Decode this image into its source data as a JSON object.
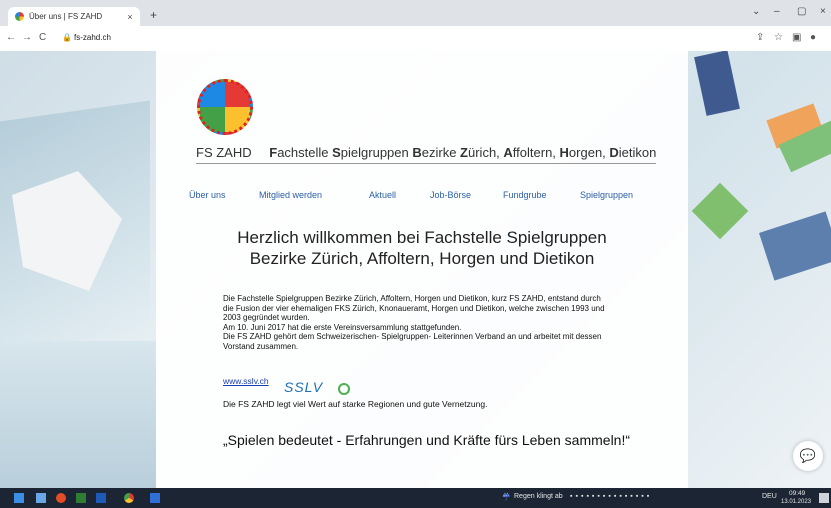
{
  "browser": {
    "tab_title": "Über uns | FS ZAHD",
    "tab_close": "×",
    "new_tab": "+",
    "url": "fs-zahd.ch",
    "win_minimize": "–",
    "win_maximize": "▢",
    "win_close": "×",
    "tab_dropdown": "⌄"
  },
  "page": {
    "brand": {
      "abbr": "FS ZAHD",
      "parts": [
        {
          "bold": "F",
          "rest": "achstelle "
        },
        {
          "bold": "S",
          "rest": "pielgruppen "
        },
        {
          "bold": "B",
          "rest": "ezirke "
        },
        {
          "bold": "Z",
          "rest": "ürich, "
        },
        {
          "bold": "A",
          "rest": "ffoltern, "
        },
        {
          "bold": "H",
          "rest": "orgen, "
        },
        {
          "bold": "D",
          "rest": "ietikon"
        }
      ]
    },
    "menu": [
      "Über uns",
      "Mitglied werden",
      "Aktuell",
      "Job-Börse",
      "Fundgrube",
      "Spielgruppen"
    ],
    "heading_line1": "Herzlich willkommen bei Fachstelle Spielgruppen",
    "heading_line2": "Bezirke Zürich, Affoltern, Horgen und Dietikon",
    "paragraph_lines": [
      "Die Fachstelle Spielgruppen Bezirke Zürich, Affoltern, Horgen und Dietikon, kurz FS ZAHD, entstand durch",
      "die Fusion der vier ehemaligen FKS Zürich, Knonaueramt, Horgen und Dietikon, welche zwischen 1993 und",
      "2003 gegründet wurden.",
      "Am 10. Juni 2017 hat die erste Vereinsversammlung stattgefunden.",
      "Die FS ZAHD gehört dem Schweizerischen- Spielgruppen- Leiterinnen Verband an und arbeitet mit dessen",
      "Vorstand zusammen."
    ],
    "sslv_link": "www.sslv.ch",
    "sslv_logo": "SSLV",
    "note": "Die FS ZAHD legt viel Wert auf starke Regionen und gute Vernetzung.",
    "quote": "„Spielen bedeutet - Erfahrungen und Kräfte fürs Leben sammeln!“"
  },
  "taskbar": {
    "weather": "Regen klingt ab",
    "lang": "DEU",
    "time": "09:49",
    "date": "13.01.2023"
  },
  "colors": {
    "menu_link": "#2c5fa8",
    "taskbar": "#1c2533"
  }
}
